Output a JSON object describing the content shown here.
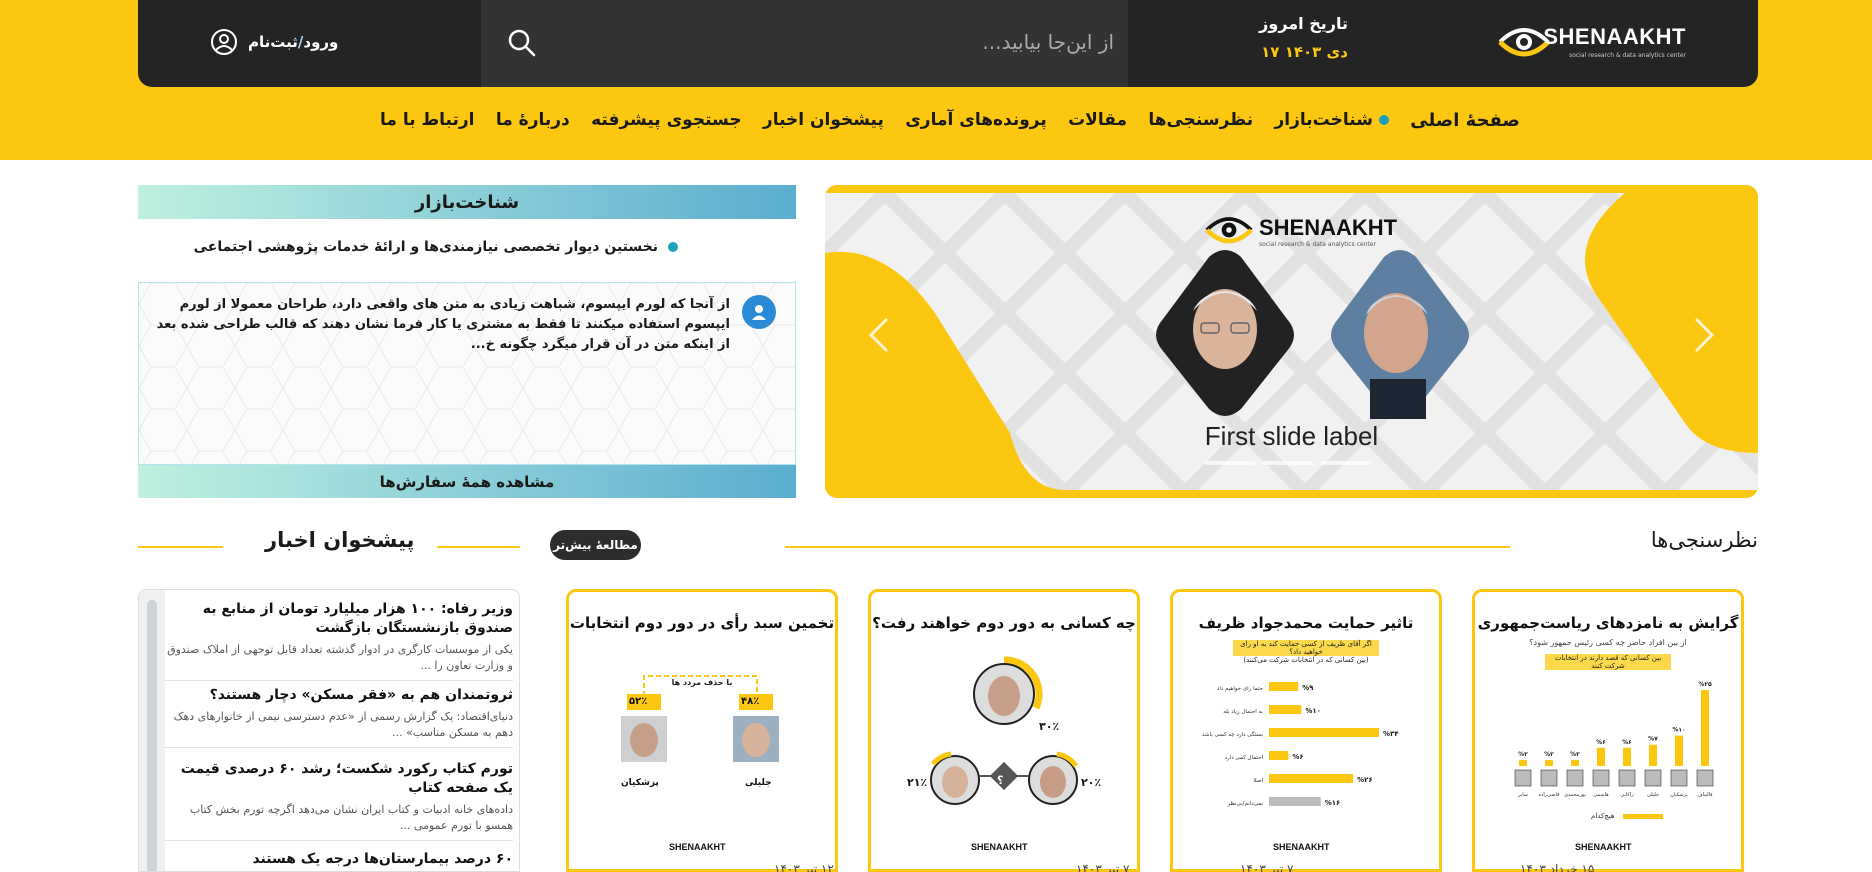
{
  "brand": {
    "name": "SHENAAKHT",
    "tagline": "social research & data analytics center",
    "colors": {
      "primary": "#fcc710",
      "dark": "#242424",
      "accent": "#1aa3b8"
    }
  },
  "header": {
    "date_label": "تاریخ امروز",
    "date_value": "۱۷ دی ۱۴۰۳",
    "search_placeholder": "از این‌جا بیابید...",
    "login_label": "ورود",
    "register_label": "ثبت‌نام",
    "login_separator": "/"
  },
  "nav": {
    "home": "صفحهٔ اصلی",
    "market": "شناخت‌بازار",
    "polls": "نظرسنجی‌ها",
    "articles": "مقالات",
    "files": "پرونده‌های آماری",
    "news": "پیشخوان اخبار",
    "search": "جستجوی پیشرفته",
    "about": "دربارهٔ ما",
    "contact": "ارتباط با ما"
  },
  "slider": {
    "label": "First slide label",
    "logo_text": "SHENAAKHT",
    "logo_sub": "social research & data analytics center",
    "slide_count": 3
  },
  "market": {
    "title": "شناخت‌بازار",
    "description": "نخستین دیوار تخصصی نیازمندی‌ها و ارائهٔ خدمات پژوهشی اجتماعی",
    "post_text": "از آنجا که لورم ایپسوم، شباهت زیادی به متن های واقعی دارد، طراحان معمولا از لورم ایپسوم استفاده میکنند تا فقط به مشتری یا کار فرما نشان دهند که قالب طراحی شده بعد از اینکه متن در آن قرار میگرد چگونه خ...",
    "footer": "مشاهده همهٔ سفارش‌ها"
  },
  "polls": {
    "title": "نظرسنجی‌ها",
    "more_button": "مطالعهٔ بیش‌تر",
    "cards": [
      {
        "title": "گرایش به نامزدهای ریاست‌جمهوری",
        "subtitle": "از بین افراد حاضر چه کسی رئیس جمهور شود؟",
        "note": "بین کسانی که قصد دارند در انتخابات شرکت کنند",
        "bars": [
          {
            "label": "قالیباف",
            "value": 25
          },
          {
            "label": "پزشکیان",
            "value": 10
          },
          {
            "label": "جلیلی",
            "value": 7
          },
          {
            "label": "زاکانی",
            "value": 6
          },
          {
            "label": "هاشمی",
            "value": 6
          },
          {
            "label": "پورمحمدی",
            "value": 2
          },
          {
            "label": "قاضی‌زاده",
            "value": 2
          },
          {
            "label": "سایر",
            "value": 2
          }
        ],
        "extra_label": "هیچ‌کدام",
        "extra_value": 40,
        "logo": "SHENAAKHT",
        "date": "۱۵ خرداد ۱۴۰۳"
      },
      {
        "title": "تاثیر حمایت محمدجواد ظریف",
        "subtitle": "اگر آقای ظریف از کسی حمایت کند به او رای خواهید داد؟",
        "note": "(بین کسانی که در انتخابات شرکت می‌کنند)",
        "bars": [
          {
            "label": "حتما رای خواهیم داد",
            "value": 9
          },
          {
            "label": "به احتمال زیاد بله",
            "value": 10
          },
          {
            "label": "بستگی دارد چه کسی باشد",
            "value": 34
          },
          {
            "label": "احتمال کمی دارد",
            "value": 6
          },
          {
            "label": "اصلا",
            "value": 26
          },
          {
            "label": "نمی‌دانم/بی‌نظر",
            "value": 16
          }
        ],
        "logo": "SHENAAKHT",
        "date": "۷ تیر ۱۴۰۳"
      },
      {
        "title": "چه کسانی به دور دوم خواهند رفت؟",
        "top_value": "۳۰٪",
        "left_value": "۲۱٪",
        "right_value": "۲۰٪",
        "question_mark": "؟",
        "logo": "SHENAAKHT",
        "date": "۷ تیر ۱۴۰۳"
      },
      {
        "title": "تخمین سبد رأی در دور دوم انتخابات",
        "caption": "با حذف مردد ها",
        "left_value": "۵۲٪",
        "right_value": "۴۸٪",
        "left_name": "پزشکیان",
        "right_name": "جلیلی",
        "logo": "SHENAAKHT",
        "date": "۱۲ تیر ۱۴۰۳"
      }
    ]
  },
  "news": {
    "title": "پیشخوان اخبار",
    "items": [
      {
        "title": "وزیر رفاه: ۱۰۰ هزار میلیارد تومان از منابع به صندوق بازنشستگان بازگشت",
        "body": "یکی از موسسات کارگری در ادوار گذشته تعداد قابل توجهی از املاک صندوق و وزارت تعاون را ..."
      },
      {
        "title": "ثروتمندان هم به «فقر مسکن» دچار هستند؟",
        "body": "دنیای‌اقتصاد: یک گزارش رسمی از «عدم دسترسی نیمی از خانوارهای دهک دهم به مسکن مناسب» ..."
      },
      {
        "title": "تورم کتاب رکورد شکست؛ رشد ۶۰ درصدی قیمت یک صفحه کتاب",
        "body": "داده‌های خانه ادبیات و کتاب ایران نشان می‌دهد اگرچه تورم بخش کتاب همسو با تورم عمومی ..."
      },
      {
        "title": "۶۰ درصد بیمارستان‌ها درجه یک هستند",
        "body": ""
      }
    ]
  }
}
